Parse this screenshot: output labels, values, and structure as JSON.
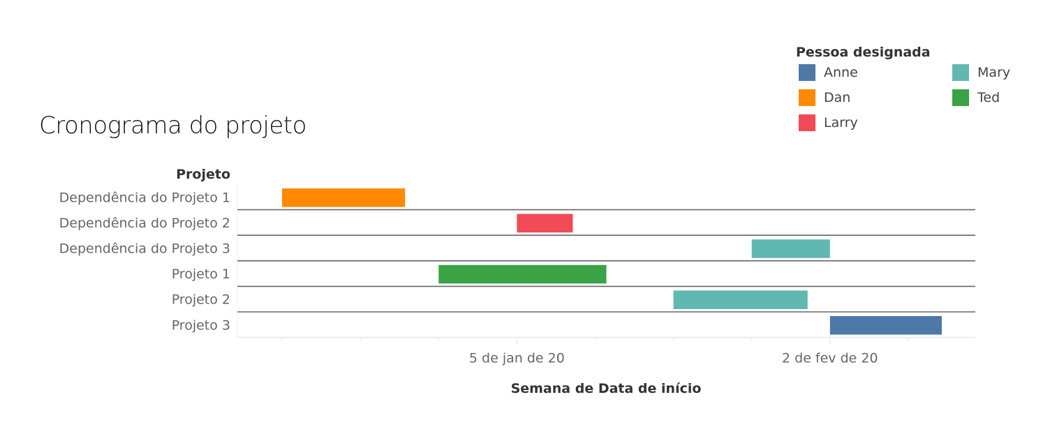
{
  "chart_data": {
    "type": "gantt",
    "title": "Cronograma do projeto",
    "ylabel": "Projeto",
    "xlabel": "Semana de Data de início",
    "x_domain": [
      "2019-12-11",
      "2020-02-15"
    ],
    "x_ticks": [
      {
        "date": "2019-12-15",
        "label": ""
      },
      {
        "date": "2019-12-22",
        "label": ""
      },
      {
        "date": "2019-12-29",
        "label": ""
      },
      {
        "date": "2020-01-05",
        "label": "5 de jan de 20"
      },
      {
        "date": "2020-01-12",
        "label": ""
      },
      {
        "date": "2020-01-19",
        "label": ""
      },
      {
        "date": "2020-01-26",
        "label": ""
      },
      {
        "date": "2020-02-02",
        "label": "2 de fev de 20"
      },
      {
        "date": "2020-02-09",
        "label": ""
      }
    ],
    "categories": [
      "Dependência do Projeto 1",
      "Dependência do Projeto 2",
      "Dependência do Projeto 3",
      "Projeto 1",
      "Projeto 2",
      "Projeto 3"
    ],
    "tasks": [
      {
        "project": "Dependência do Projeto 1",
        "person": "Dan",
        "start": "2019-12-15",
        "duration_days": 11
      },
      {
        "project": "Dependência do Projeto 2",
        "person": "Larry",
        "start": "2020-01-05",
        "duration_days": 5
      },
      {
        "project": "Dependência do Projeto 3",
        "person": "Mary",
        "start": "2020-01-26",
        "duration_days": 7
      },
      {
        "project": "Projeto 1",
        "person": "Ted",
        "start": "2019-12-29",
        "duration_days": 15
      },
      {
        "project": "Projeto 2",
        "person": "Mary",
        "start": "2020-01-19",
        "duration_days": 12
      },
      {
        "project": "Projeto 3",
        "person": "Anne",
        "start": "2020-02-02",
        "duration_days": 10
      }
    ],
    "legend": {
      "title": "Pessoa designada",
      "position": "top-right",
      "entries": [
        {
          "name": "Anne",
          "color": "#4e79a7"
        },
        {
          "name": "Mary",
          "color": "#61b8b1"
        },
        {
          "name": "Dan",
          "color": "#ff8a00"
        },
        {
          "name": "Ted",
          "color": "#3aa345"
        },
        {
          "name": "Larry",
          "color": "#f04b57"
        }
      ]
    }
  }
}
